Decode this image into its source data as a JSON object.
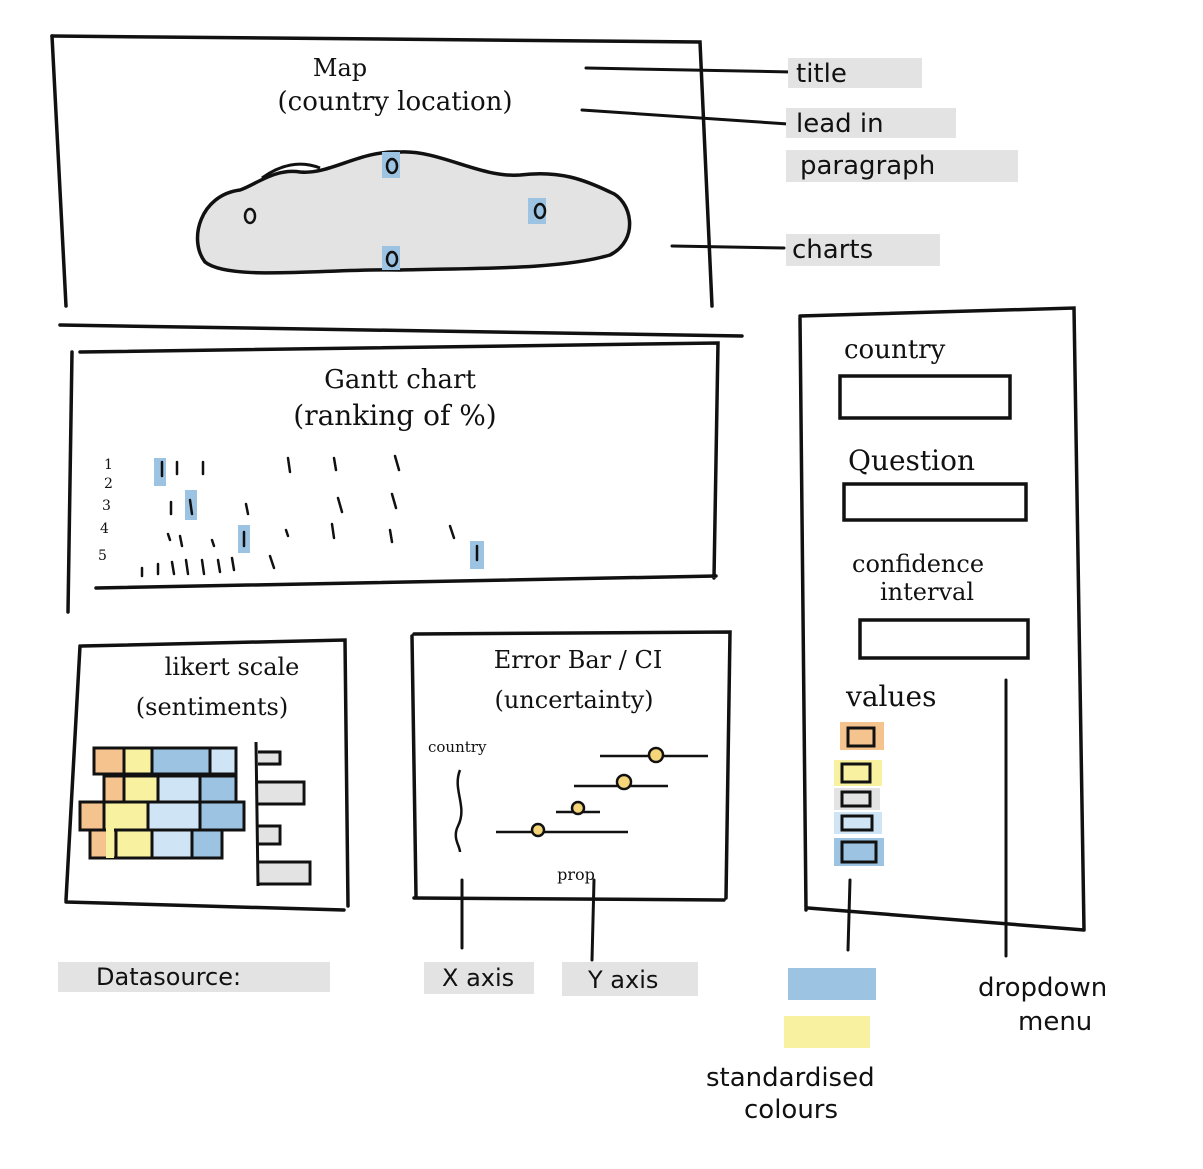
{
  "map_panel": {
    "title": "Map",
    "subtitle": "(country location)"
  },
  "gantt_panel": {
    "title": "Gantt chart",
    "subtitle": "(ranking of %)",
    "rank_labels": [
      "1",
      "2",
      "3",
      "4",
      "5"
    ]
  },
  "likert_panel": {
    "title": "likert scale",
    "subtitle": "(sentiments)"
  },
  "errorbar_panel": {
    "title": "Error Bar / CI",
    "subtitle": "(uncertainty)",
    "y_label": "country",
    "x_label": "prop"
  },
  "sidebar": {
    "country_label": "country",
    "question_label": "Question",
    "ci_label_line1": "confidence",
    "ci_label_line2": "interval",
    "values_label": "values"
  },
  "annotations": {
    "title": "title",
    "lead_in_line1": "lead in",
    "lead_in_line2": "paragraph",
    "charts": "charts",
    "data_source": "Datasource:",
    "x_axis": "X axis",
    "y_axis": "Y axis",
    "dropdown_line1": "dropdown",
    "dropdown_line2": "menu",
    "standardised_line1": "standardised",
    "standardised_line2": "colours"
  },
  "colors": {
    "blue": "#9dc3e3",
    "light_blue": "#cfe4f5",
    "yellow": "#f8f2a0",
    "orange": "#f5c48e",
    "grey": "#e3e3e3",
    "ink": "#111111"
  },
  "icons": [
    "map-blob-icon",
    "map-marker-icon"
  ]
}
